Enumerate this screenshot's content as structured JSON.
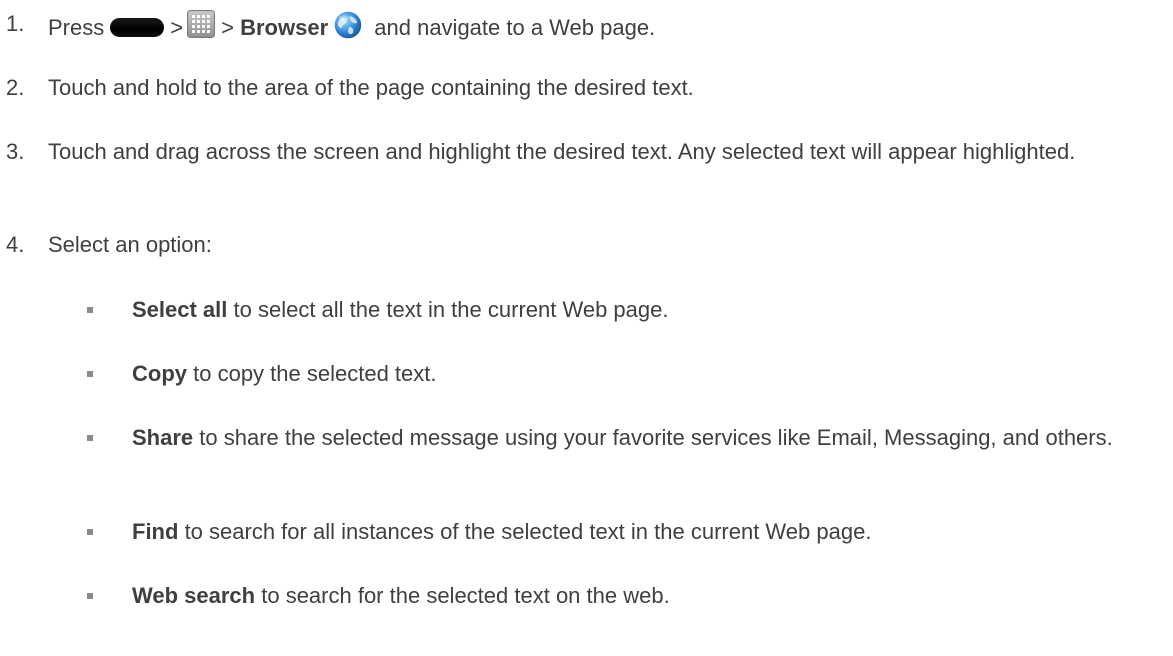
{
  "steps": [
    {
      "number": "1.",
      "parts": {
        "press": "Press",
        "sep1": ">",
        "sep2": ">",
        "browser_label": "Browser",
        "tail": "and navigate to a Web page."
      },
      "icons": [
        "home-button-icon",
        "apps-grid-icon",
        "browser-globe-icon"
      ]
    },
    {
      "number": "2.",
      "text": "Touch and hold to the area of the page containing the desired text."
    },
    {
      "number": "3.",
      "text": "Touch and drag across the screen and highlight the desired text. Any selected text will appear highlighted."
    },
    {
      "number": "4.",
      "text": "Select an option:"
    }
  ],
  "options": [
    {
      "label": "Select all",
      "description": "to select all the text in the current Web page."
    },
    {
      "label": "Copy",
      "description": "to copy the selected text."
    },
    {
      "label": "Share",
      "description": "to share the selected message using your favorite services like Email, Messaging, and others."
    },
    {
      "label": "Find",
      "description": "to search for all instances of the selected text in the current Web page."
    },
    {
      "label": "Web search",
      "description": "to search for the selected text on the web."
    }
  ],
  "colors": {
    "text": "#3f3f3f",
    "bullet": "#8a8a8a"
  }
}
